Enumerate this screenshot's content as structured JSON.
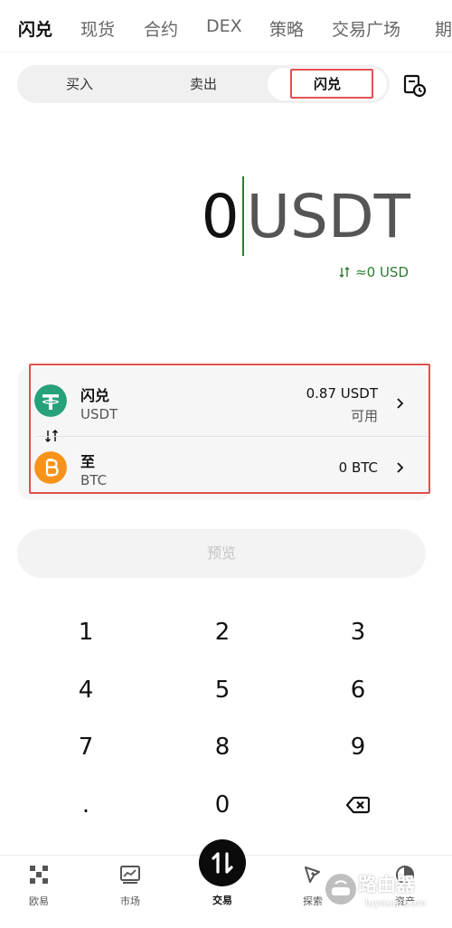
{
  "top_tabs": [
    "闪兑",
    "现货",
    "合约",
    "DEX",
    "策略",
    "交易广场",
    "期"
  ],
  "segment": {
    "buy": "买入",
    "sell": "卖出",
    "swap": "闪兑"
  },
  "amount": {
    "value": "0",
    "unit": "USDT",
    "approx": "≈0 USD"
  },
  "from": {
    "title": "闪兑",
    "symbol": "USDT",
    "balance": "0.87 USDT",
    "balance_label": "可用"
  },
  "to": {
    "title": "至",
    "symbol": "BTC",
    "balance": "0 BTC"
  },
  "preview_label": "预览",
  "keypad": [
    "1",
    "2",
    "3",
    "4",
    "5",
    "6",
    "7",
    "8",
    "9",
    ".",
    "0"
  ],
  "bottom_nav": {
    "home": "欧易",
    "market": "市场",
    "trade": "交易",
    "explore": "探索",
    "assets": "资产"
  },
  "watermark": {
    "text": "路由器",
    "sub": "luyouqi.com"
  },
  "colors": {
    "accent_green": "#2e7d32",
    "usdt": "#26a17b",
    "btc": "#f7931a",
    "highlight_red": "#e05050"
  },
  "icons": [
    "history-icon",
    "swap-arrows-icon",
    "usdt-icon",
    "btc-icon",
    "chevron-right-icon",
    "backspace-icon",
    "okx-logo-icon",
    "market-chart-icon",
    "trade-swap-icon",
    "explore-icon",
    "assets-pie-icon"
  ]
}
